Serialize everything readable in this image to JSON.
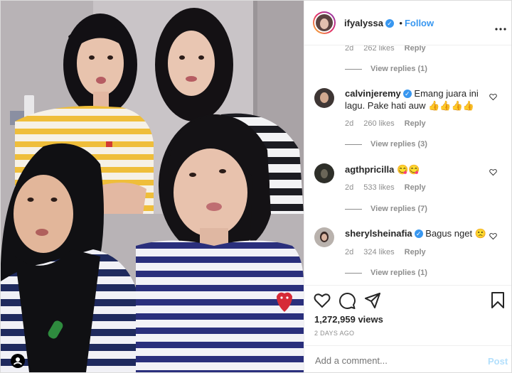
{
  "post": {
    "username": "ifyalyssa",
    "follow_label": "Follow",
    "separator": "•"
  },
  "comments": [
    {
      "username": "",
      "text": "",
      "time": "2d",
      "likes": "262 likes",
      "reply": "Reply",
      "view_replies": "View replies (1)"
    },
    {
      "username": "calvinjeremy",
      "text": "Emang juara ini lagu. Pake hati auw 👍👍👍👍",
      "time": "2d",
      "likes": "260 likes",
      "reply": "Reply",
      "view_replies": "View replies (3)"
    },
    {
      "username": "agthpricilla",
      "text": "😋😋",
      "time": "2d",
      "likes": "533 likes",
      "reply": "Reply",
      "view_replies": "View replies (7)"
    },
    {
      "username": "sherylsheinafia",
      "text": "Bagus nget 🙁",
      "time": "2d",
      "likes": "324 likes",
      "reply": "Reply",
      "view_replies": "View replies (1)"
    }
  ],
  "stats": {
    "views": "1,272,959 views",
    "posted": "2 DAYS AGO"
  },
  "composer": {
    "placeholder": "Add a comment...",
    "post_label": "Post"
  },
  "icons": [
    "like-icon",
    "comment-icon",
    "share-icon",
    "save-icon",
    "more-options-icon",
    "verified-badge-icon",
    "user-tag-icon"
  ],
  "colors": {
    "accent": "#3897f0",
    "muted": "#8e8e8e",
    "text": "#262626",
    "border": "#efefef"
  }
}
